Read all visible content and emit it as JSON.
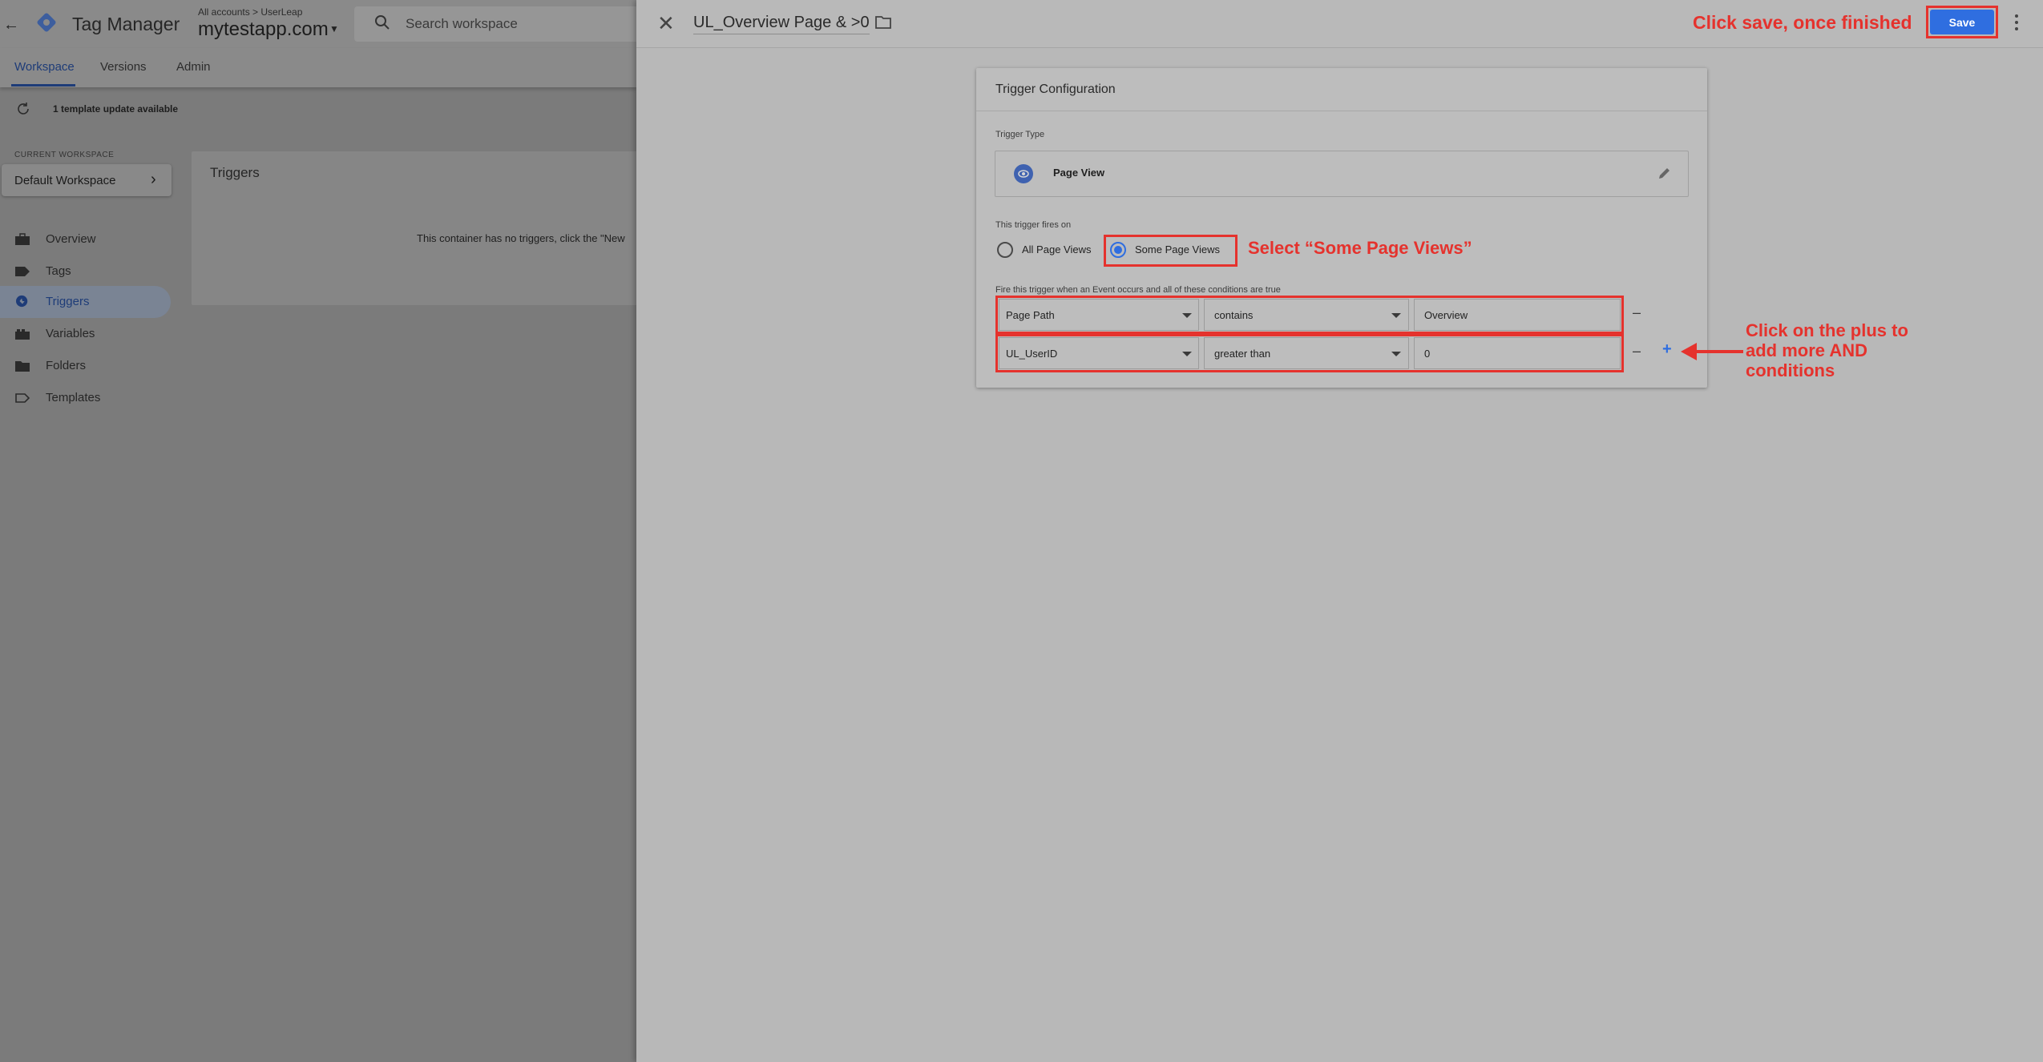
{
  "app": {
    "title": "Tag Manager",
    "breadcrumb": "All accounts > UserLeap",
    "account": "mytestapp.com"
  },
  "search": {
    "placeholder": "Search workspace"
  },
  "tabs": [
    {
      "label": "Workspace",
      "active": true
    },
    {
      "label": "Versions",
      "active": false
    },
    {
      "label": "Admin",
      "active": false
    }
  ],
  "update_banner": "1 template update available",
  "workspace": {
    "label": "CURRENT WORKSPACE",
    "name": "Default Workspace"
  },
  "sidebar": {
    "items": [
      {
        "label": "Overview",
        "icon": "briefcase-icon",
        "active": false
      },
      {
        "label": "Tags",
        "icon": "tag-icon",
        "active": false
      },
      {
        "label": "Triggers",
        "icon": "trigger-icon",
        "active": true
      },
      {
        "label": "Variables",
        "icon": "variables-icon",
        "active": false
      },
      {
        "label": "Folders",
        "icon": "folder-icon",
        "active": false
      },
      {
        "label": "Templates",
        "icon": "template-icon",
        "active": false
      }
    ]
  },
  "triggers_list": {
    "title": "Triggers",
    "empty_text": "This container has no triggers, click the \"New"
  },
  "editor": {
    "trigger_name": "UL_Overview Page & >0",
    "save_label": "Save",
    "card_title": "Trigger Configuration",
    "trigger_type_label": "Trigger Type",
    "trigger_type": "Page View",
    "fires_on_label": "This trigger fires on",
    "radio_all": "All Page Views",
    "radio_some": "Some Page Views",
    "radio_selected": "Some Page Views",
    "conditions_label": "Fire this trigger when an Event occurs and all of these conditions are true",
    "conditions": [
      {
        "variable": "Page Path",
        "operator": "contains",
        "value": "Overview"
      },
      {
        "variable": "UL_UserID",
        "operator": "greater than",
        "value": "0"
      }
    ]
  },
  "annotations": {
    "save": "Click save, once finished",
    "some_page_views": "Select “Some Page Views”",
    "plus": "Click on the plus to add more AND conditions"
  },
  "colors": {
    "annotation": "#e5322d",
    "primary": "#2f6ee0"
  }
}
